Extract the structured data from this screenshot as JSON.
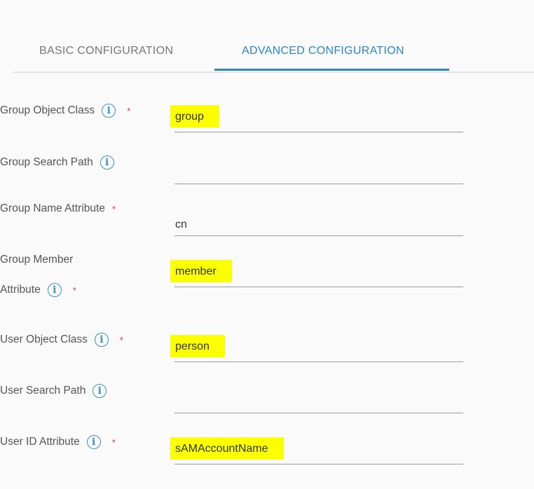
{
  "tabs": [
    {
      "label": "BASIC CONFIGURATION",
      "active": false
    },
    {
      "label": "ADVANCED CONFIGURATION",
      "active": true
    }
  ],
  "fields": [
    {
      "label": "Group Object Class",
      "info": true,
      "required": true,
      "value": "group",
      "highlighted": true
    },
    {
      "label": "Group Search Path",
      "info": true,
      "required": false,
      "value": "",
      "highlighted": false
    },
    {
      "label": "Group Name Attribute",
      "info": false,
      "required": true,
      "value": "cn",
      "highlighted": false
    },
    {
      "label_line1": "Group Member",
      "label_line2": "Attribute",
      "info": true,
      "required": true,
      "value": "member",
      "highlighted": true
    },
    {
      "label": "User Object Class",
      "info": true,
      "required": true,
      "value": "person",
      "highlighted": true
    },
    {
      "label": "User Search Path",
      "info": true,
      "required": false,
      "value": "",
      "highlighted": false
    },
    {
      "label": "User ID Attribute",
      "info": true,
      "required": true,
      "value": "sAMAccountName",
      "highlighted": true
    }
  ],
  "icons": {
    "info": "i",
    "required": "*"
  },
  "colors": {
    "accent": "#2a86c4",
    "highlight": "#fbff00",
    "required": "#d04040"
  }
}
